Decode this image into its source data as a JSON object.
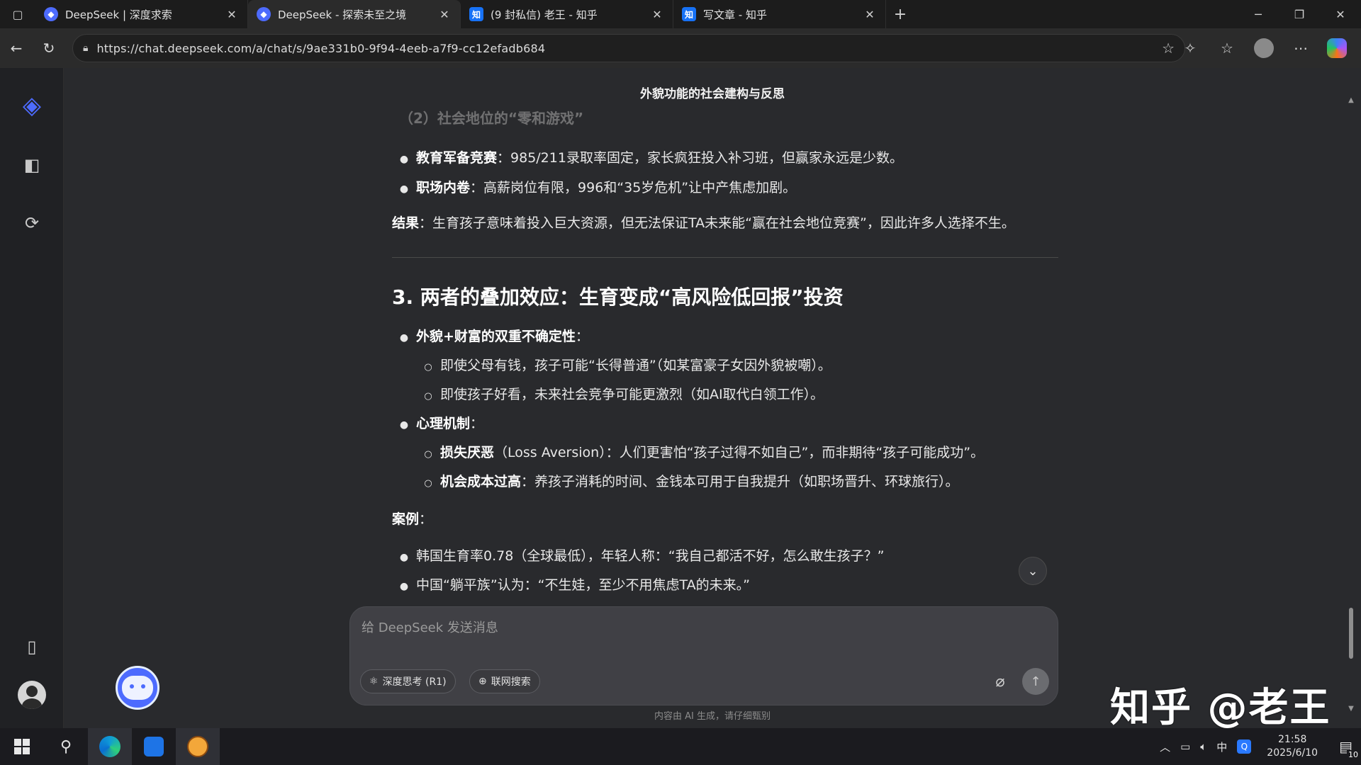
{
  "browser": {
    "tabs": [
      {
        "label": "DeepSeek | 深度求索",
        "favicon": "deepseek-icon",
        "active": false
      },
      {
        "label": "DeepSeek - 探索未至之境",
        "favicon": "deepseek-icon",
        "active": true
      },
      {
        "label": "(9 封私信) 老王 - 知乎",
        "favicon": "zhihu-icon",
        "fav_text": "知",
        "active": false
      },
      {
        "label": "写文章 - 知乎",
        "favicon": "zhihu-icon",
        "fav_text": "知",
        "active": false
      }
    ],
    "url": "https://chat.deepseek.com/a/chat/s/9ae331b0-9f94-4eeb-a7f9-cc12efadb684"
  },
  "page": {
    "title": "外貌功能的社会建构与反思",
    "cut_heading": "（2）社会地位的“零和游戏”",
    "section2_bullets": [
      {
        "bold": "教育军备竞赛",
        "text": "：985/211录取率固定，家长疯狂投入补习班，但赢家永远是少数。"
      },
      {
        "bold": "职场内卷",
        "text": "：高薪岗位有限，996和“35岁危机”让中产焦虑加剧。"
      }
    ],
    "result": {
      "bold": "结果",
      "text": "：生育孩子意味着投入巨大资源，但无法保证TA未来能“赢在社会地位竞赛”，因此许多人选择不生。"
    },
    "heading3": "3. 两者的叠加效应：生育变成“高风险低回报”投资",
    "b1": {
      "bold": "外貌+财富的双重不确定性",
      "text": "："
    },
    "b1_subs": [
      {
        "text": "即使父母有钱，孩子可能“长得普通”（如某富豪子女因外貌被嘲）。"
      },
      {
        "text": "即使孩子好看，未来社会竞争可能更激烈（如AI取代白领工作）。"
      }
    ],
    "b2": {
      "bold": "心理机制",
      "text": "："
    },
    "b2_subs": [
      {
        "bold": "损失厌恶",
        "text": "（Loss Aversion）：人们更害怕“孩子过得不如自己”，而非期待“孩子可能成功”。"
      },
      {
        "bold": "机会成本过高",
        "text": "：养孩子消耗的时间、金钱本可用于自我提升（如职场晋升、环球旅行）。"
      }
    ],
    "case_label": {
      "bold": "案例",
      "text": "："
    },
    "cases": [
      {
        "text": "韩国生育率0.78（全球最低），年轻人称：“我自己都活不好，怎么敢生孩子？”"
      },
      {
        "text": "中国“躺平族”认为：“不生娃，至少不用焦虑TA的未来。”"
      }
    ]
  },
  "composer": {
    "placeholder": "给 DeepSeek 发送消息",
    "deep_think": "深度思考 (R1)",
    "web_search": "联网搜索"
  },
  "disclaimer": "内容由 AI 生成，请仔细甄别",
  "watermark": "知乎 @老王",
  "taskbar": {
    "time": "21:58",
    "date": "2025/6/10",
    "ime": "中",
    "notifications": "10"
  },
  "colors": {
    "accent": "#4d6bfe",
    "background": "#292a2d",
    "sidebar": "#202124"
  }
}
